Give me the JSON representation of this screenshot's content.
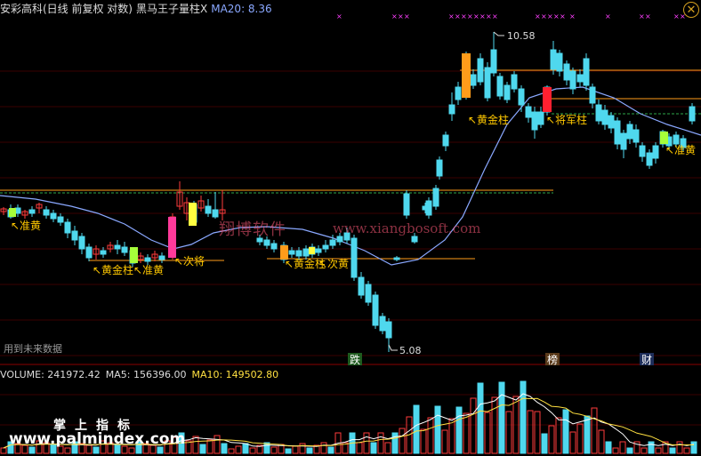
{
  "header": {
    "stock": "安彩高科(日线 前复权 对数)",
    "indicator": "黑马王子量柱X",
    "ma_label": "MA20: 8.36"
  },
  "volume_header": {
    "volume": "VOLUME: 241972.42",
    "ma5": "MA5: 156396.00",
    "ma10": "MA10: 149502.80"
  },
  "watermarks": {
    "future_data": "用到未来数据",
    "company": "翔博软件",
    "site": "www.xiangbosoft.com",
    "palm_cn": "掌上指标",
    "palm_url": "www.palmindex.com"
  },
  "chart_data": {
    "type": "candlestick",
    "price_high_label": "10.58",
    "price_low_label": "5.08",
    "signals": [
      {
        "label": "准黄"
      },
      {
        "label": "黄金柱"
      },
      {
        "label": "准黄"
      },
      {
        "label": "次将"
      },
      {
        "label": "黄金柱"
      },
      {
        "label": "次黄"
      },
      {
        "label": "黄金柱"
      },
      {
        "label": "将军柱"
      },
      {
        "label": "准黄"
      }
    ],
    "event_markers": [
      "跌",
      "榜",
      "财"
    ],
    "colors": {
      "up": "#ff3b3b",
      "down": "#4fd8ee",
      "ma": "#8aa8ff",
      "gold": "#ff9c1a",
      "zhunhuang": "#a6ff3a",
      "general": "#ff2030",
      "cijiang": "#ff3a9a",
      "cihuang": "#ffff40",
      "signal_text": "#ffc800",
      "marker_x": "#ff40ff"
    }
  }
}
